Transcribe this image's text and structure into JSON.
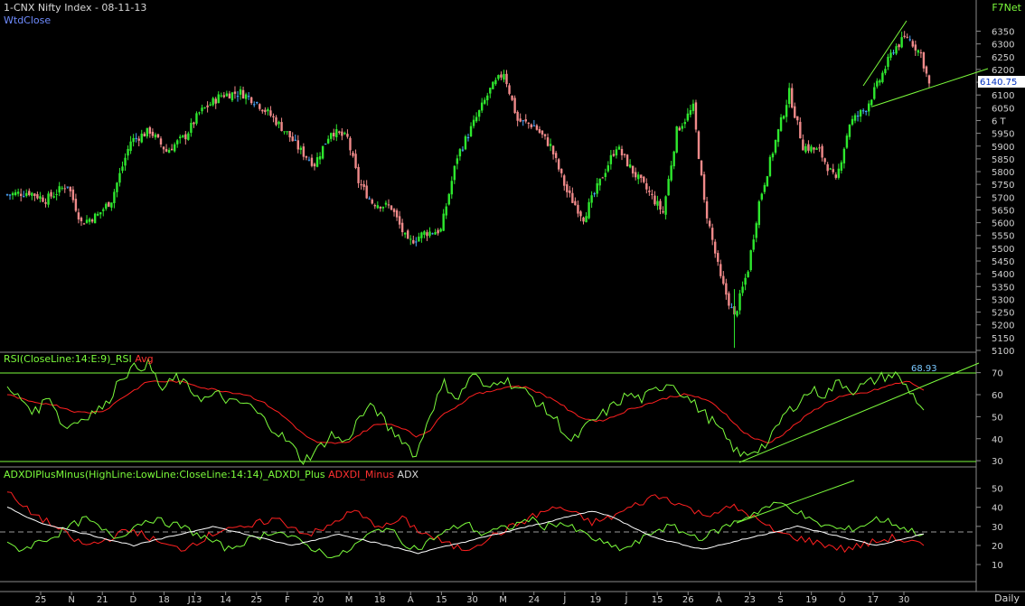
{
  "header": {
    "title": "1-CNX Nifty Index - 08-11-13",
    "brand": "F7Net",
    "series_label": "WtdClose",
    "last_price": "6140.75",
    "timeframe": "Daily"
  },
  "colors": {
    "background": "#000000",
    "up_candle": "#2ee82e",
    "down_candle": "#f08a8a",
    "doji_candle": "#4aa8ff",
    "trendline": "#7cfc3c",
    "rsi_line": "#7cfc3c",
    "rsi_avg": "#ff2020",
    "adx_plus": "#7cfc3c",
    "adx_minus": "#ff2020",
    "adx": "#ffffff",
    "axis_text": "#d0d0d0"
  },
  "panels": {
    "rsi": {
      "label_main": "RSI(CloseLine:14:E:9)_RSI",
      "label_avg": "Avg",
      "last_value": "68.93"
    },
    "adx": {
      "label_main": "ADXDIPlusMinus(HighLine:LowLine:CloseLine:14:14)_ADXDI_Plus",
      "label_minus": "ADXDI_Minus",
      "label_adx": "ADX"
    }
  },
  "chart_data": [
    {
      "type": "candlestick",
      "title": "1-CNX Nifty Index - 08-11-13",
      "ylim": [
        5100,
        6380
      ],
      "yticks": [
        "6350",
        "6300",
        "6250",
        "6200",
        "6150",
        "6100",
        "6050",
        "6 T",
        "5950",
        "5900",
        "5850",
        "5800",
        "5750",
        "5700",
        "5650",
        "5600",
        "5550",
        "5500",
        "5450",
        "5400",
        "5350",
        "5300",
        "5250",
        "5200",
        "5150",
        "5100"
      ],
      "x_ticks": [
        "25",
        "N",
        "21",
        "D",
        "18",
        "J13",
        "14",
        "25",
        "F",
        "20",
        "M",
        "18",
        "A",
        "15",
        "30",
        "M",
        "24",
        "J",
        "19",
        "J",
        "15",
        "26",
        "A",
        "23",
        "S",
        "19",
        "O",
        "17",
        "30"
      ],
      "close_path": [
        [
          0,
          5710
        ],
        [
          8,
          5720
        ],
        [
          14,
          5690
        ],
        [
          22,
          5750
        ],
        [
          27,
          5600
        ],
        [
          33,
          5630
        ],
        [
          38,
          5690
        ],
        [
          45,
          5920
        ],
        [
          52,
          5960
        ],
        [
          58,
          5880
        ],
        [
          65,
          5940
        ],
        [
          70,
          6030
        ],
        [
          78,
          6100
        ],
        [
          85,
          6110
        ],
        [
          90,
          6080
        ],
        [
          96,
          6020
        ],
        [
          102,
          5950
        ],
        [
          107,
          5880
        ],
        [
          112,
          5830
        ],
        [
          118,
          5960
        ],
        [
          124,
          5930
        ],
        [
          128,
          5760
        ],
        [
          133,
          5680
        ],
        [
          140,
          5660
        ],
        [
          146,
          5520
        ],
        [
          152,
          5560
        ],
        [
          158,
          5570
        ],
        [
          164,
          5860
        ],
        [
          170,
          5990
        ],
        [
          176,
          6120
        ],
        [
          181,
          6190
        ],
        [
          186,
          6000
        ],
        [
          192,
          5980
        ],
        [
          198,
          5900
        ],
        [
          204,
          5720
        ],
        [
          210,
          5620
        ],
        [
          216,
          5760
        ],
        [
          222,
          5900
        ],
        [
          228,
          5800
        ],
        [
          233,
          5730
        ],
        [
          239,
          5640
        ],
        [
          244,
          5960
        ],
        [
          250,
          6050
        ],
        [
          254,
          5680
        ],
        [
          260,
          5380
        ],
        [
          265,
          5230
        ],
        [
          270,
          5420
        ],
        [
          274,
          5680
        ],
        [
          280,
          5920
        ],
        [
          285,
          6110
        ],
        [
          290,
          5900
        ],
        [
          296,
          5880
        ],
        [
          302,
          5760
        ],
        [
          307,
          5990
        ],
        [
          313,
          6050
        ],
        [
          318,
          6160
        ],
        [
          323,
          6280
        ],
        [
          328,
          6330
        ],
        [
          333,
          6260
        ],
        [
          336,
          6140
        ]
      ],
      "last_price": 6140.75
    },
    {
      "type": "line",
      "title": "RSI(CloseLine:14:E:9)_RSI",
      "ylim": [
        28,
        76
      ],
      "yticks": [
        70,
        60,
        50,
        40,
        30
      ],
      "horizontal_lines": [
        70,
        30
      ],
      "series": [
        {
          "name": "RSI(CloseLine:14:E:9)_RSI",
          "values": [
            62,
            58,
            52,
            60,
            45,
            48,
            52,
            55,
            68,
            72,
            74,
            62,
            68,
            62,
            58,
            60,
            56,
            56,
            50,
            44,
            38,
            30,
            35,
            42,
            38,
            50,
            55,
            45,
            40,
            32,
            52,
            65,
            58,
            70,
            62,
            68,
            64,
            60,
            54,
            48,
            38,
            45,
            50,
            55,
            60,
            58,
            62,
            66,
            60,
            54,
            48,
            40,
            32,
            35,
            38,
            50,
            56,
            62,
            60,
            66,
            62,
            65,
            68,
            69,
            62,
            53
          ]
        },
        {
          "name": "Avg",
          "values": [
            60,
            58,
            56,
            56,
            54,
            52,
            52,
            53,
            58,
            62,
            66,
            66,
            66,
            65,
            63,
            62,
            61,
            60,
            57,
            53,
            48,
            42,
            38,
            38,
            38,
            42,
            46,
            47,
            45,
            41,
            44,
            52,
            55,
            60,
            61,
            63,
            64,
            63,
            60,
            57,
            52,
            49,
            48,
            50,
            53,
            55,
            57,
            59,
            60,
            59,
            56,
            51,
            44,
            40,
            38,
            42,
            47,
            52,
            56,
            59,
            60,
            61,
            63,
            65,
            66,
            62
          ]
        }
      ],
      "last_value": 68.93
    },
    {
      "type": "line",
      "title": "ADXDIPlusMinus(HighLine:LowLine:CloseLine:14:14)_ADXDI_Plus",
      "ylim": [
        2,
        55
      ],
      "yticks": [
        50,
        40,
        30,
        20,
        10
      ],
      "series": [
        {
          "name": "ADXDI_Plus",
          "values": [
            20,
            18,
            22,
            25,
            30,
            34,
            28,
            24,
            30,
            34,
            32,
            30,
            26,
            22,
            18,
            22,
            25,
            28,
            24,
            20,
            16,
            14,
            20,
            26,
            30,
            22,
            18,
            24,
            28,
            32,
            26,
            28,
            30,
            34,
            30,
            32,
            28,
            24,
            20,
            18,
            22,
            28,
            30,
            26,
            24,
            28,
            32,
            36,
            40,
            42,
            38,
            32,
            30,
            28,
            30,
            34,
            32,
            28,
            26
          ]
        },
        {
          "name": "ADXDI_Minus",
          "values": [
            48,
            40,
            35,
            30,
            24,
            20,
            22,
            26,
            28,
            24,
            20,
            18,
            22,
            26,
            30,
            28,
            32,
            34,
            30,
            26,
            28,
            34,
            38,
            32,
            30,
            34,
            28,
            24,
            20,
            18,
            22,
            26,
            30,
            34,
            38,
            40,
            36,
            32,
            34,
            38,
            42,
            46,
            44,
            40,
            36,
            38,
            40,
            36,
            30,
            26,
            24,
            22,
            20,
            18,
            20,
            22,
            24,
            22,
            20
          ]
        },
        {
          "name": "ADX",
          "values": [
            40,
            36,
            32,
            30,
            28,
            26,
            24,
            22,
            20,
            22,
            24,
            26,
            28,
            30,
            28,
            26,
            24,
            22,
            20,
            22,
            24,
            26,
            24,
            22,
            20,
            18,
            16,
            18,
            20,
            22,
            24,
            26,
            28,
            30,
            32,
            34,
            36,
            38,
            36,
            32,
            28,
            24,
            22,
            20,
            18,
            20,
            22,
            24,
            26,
            28,
            30,
            28,
            26,
            24,
            22,
            20,
            22,
            24,
            26
          ]
        }
      ]
    }
  ]
}
